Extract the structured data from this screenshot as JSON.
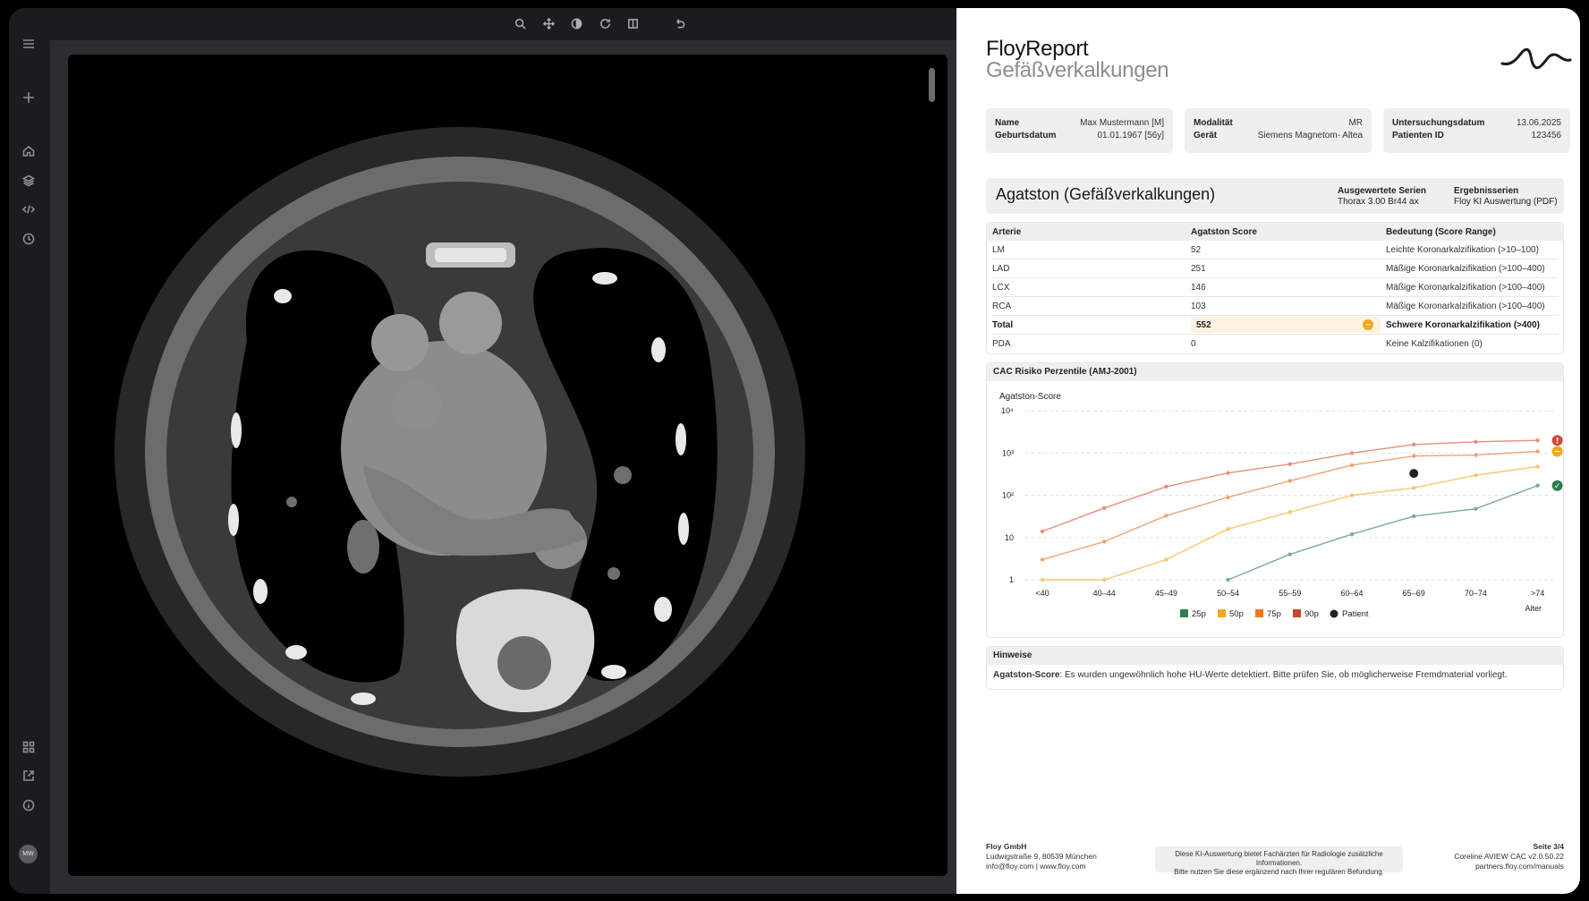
{
  "report": {
    "brand": "FloyReport",
    "subtitle": "Gefäßverkalkungen",
    "patient": {
      "name_label": "Name",
      "name_value": "Max Mustermann [M]",
      "dob_label": "Geburtsdatum",
      "dob_value": "01.01.1967 [56y]"
    },
    "device": {
      "modality_label": "Modalität",
      "modality_value": "MR",
      "device_label": "Gerät",
      "device_value": "Siemens Magnetom- Altea"
    },
    "exam": {
      "date_label": "Untersuchungsdatum",
      "date_value": "13.06.2025",
      "pid_label": "Patienten ID",
      "pid_value": "123456"
    },
    "agatston": {
      "title": "Agatston (Gefäßverkalkungen)",
      "series_label": "Ausgewertete Serien",
      "series_value": "Thorax 3.00 Br44 ax",
      "result_label": "Ergebnisserien",
      "result_value": "Floy KI Auswertung (PDF)"
    },
    "table": {
      "headers": [
        "Arterie",
        "Agatston Score",
        "Bedeutung (Score Range)"
      ],
      "rows": [
        [
          "LM",
          "52",
          "Leichte Koronarkalzifikation (>10–100)"
        ],
        [
          "LAD",
          "251",
          "Mäßige Koronarkalzifikation (>100–400)"
        ],
        [
          "LCX",
          "146",
          "Mäßige Koronarkalzifikation (>100–400)"
        ],
        [
          "RCA",
          "103",
          "Mäßige Koronarkalzifikation (>100–400)"
        ],
        [
          "Total",
          "552",
          "Schwere Koronarkalzifikation (>400)"
        ],
        [
          "PDA",
          "0",
          "Keine Kalzifikationen (0)"
        ]
      ],
      "total_status_icon": "minus-circle-icon"
    },
    "cac_title": "CAC Risiko Perzentile (AMJ-2001)",
    "hinweise_title": "Hinweise",
    "hinweise_key": "Agatston-Score",
    "hinweise_text": ": Es wurden ungewöhnlich hohe HU-Werte detektiert. Bitte prüfen Sie, ob möglicherweise Fremdmaterial vorliegt.",
    "footer": {
      "company": "Floy GmbH",
      "address": "Ludwigstraße 9, 80539 München",
      "contact": "info@floy.com | www.floy.com",
      "disclaimer_1": "Diese KI-Auswertung bietet Fachärzten für Radiologie zusätzliche Informationen.",
      "disclaimer_2": "Bitte nutzen Sie diese ergänzend nach Ihrer regulären Befundung.",
      "page": "Seite 3/4",
      "version": "Coreline AVIEW CAC v2.0.50.22",
      "manual": "partners.floy.com/manuals"
    }
  },
  "viewer": {
    "avatar": "MW",
    "sidebar_icons": [
      "menu-icon",
      "plus-icon",
      "home-icon",
      "layers-icon",
      "code-icon",
      "history-icon",
      "grid-icon",
      "external-link-icon",
      "info-icon"
    ],
    "toolbar_icons": [
      "zoom-icon",
      "pan-icon",
      "contrast-icon",
      "rotate-icon",
      "split-view-icon",
      "undo-icon"
    ]
  },
  "chart_data": {
    "type": "line",
    "ylabel": "Agatston-Score",
    "xlabel": "Alter",
    "yscale": "log",
    "y_ticks": [
      "1",
      "10",
      "10²",
      "10³",
      "10⁴"
    ],
    "categories": [
      "<40",
      "40–44",
      "45–49",
      "50–54",
      "55–59",
      "60–64",
      "65–69",
      "70–74",
      ">74"
    ],
    "series": [
      {
        "name": "25p",
        "color": "#7aab98",
        "values": [
          null,
          null,
          null,
          1,
          4,
          12,
          32,
          48,
          170
        ]
      },
      {
        "name": "50p",
        "color": "#f5c66b",
        "values": [
          1,
          1,
          3,
          16,
          40,
          100,
          150,
          300,
          480
        ]
      },
      {
        "name": "75p",
        "color": "#f0a370",
        "values": [
          3,
          8,
          33,
          90,
          220,
          520,
          850,
          900,
          1100
        ]
      },
      {
        "name": "90p",
        "color": "#e4907c",
        "values": [
          14,
          50,
          160,
          340,
          550,
          1000,
          1600,
          1850,
          2000
        ]
      }
    ],
    "legend": [
      {
        "name": "25p",
        "color": "#2e7d4f"
      },
      {
        "name": "50p",
        "color": "#f0a81e"
      },
      {
        "name": "75p",
        "color": "#ee7a21"
      },
      {
        "name": "90p",
        "color": "#c9472a"
      },
      {
        "name": "Patient",
        "color": "#222222"
      }
    ],
    "patient_point": {
      "x": "65–69",
      "y": 330
    },
    "markers": [
      {
        "series": "90p",
        "icon": "alert-icon",
        "color": "#d4453a",
        "symbol": "!"
      },
      {
        "series": "75p",
        "icon": "minus-icon",
        "color": "#f0a81e",
        "symbol": "−"
      },
      {
        "series": "25p",
        "icon": "check-icon",
        "color": "#2e7d4f",
        "symbol": "✓"
      }
    ],
    "legend_placement": "bottom",
    "grid": true
  }
}
